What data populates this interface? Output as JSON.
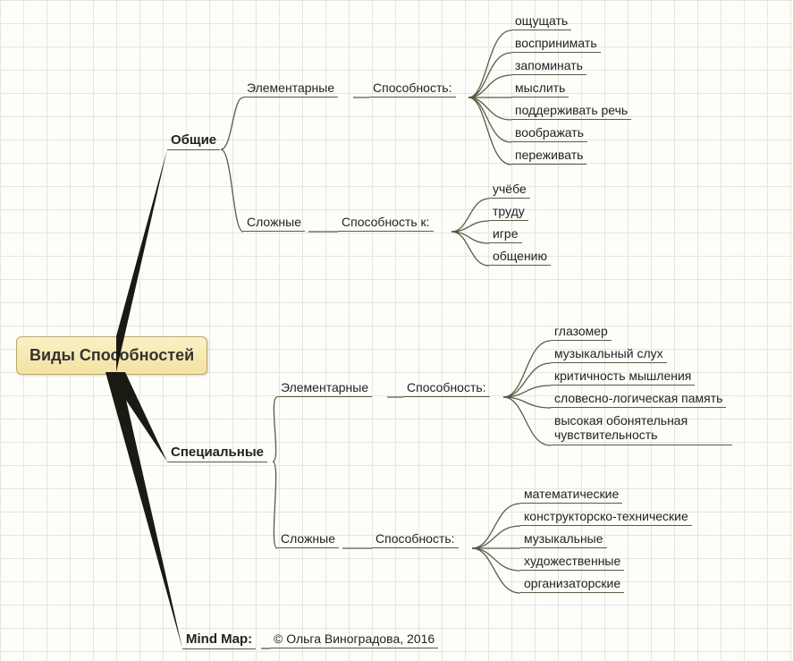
{
  "root": "Виды Способностей",
  "branches": {
    "general": {
      "label": "Общие",
      "elementary": {
        "label": "Элементарные",
        "heading": "Способность:",
        "items": [
          "ощущать",
          "воспринимать",
          "запоминать",
          "мыслить",
          "поддерживать речь",
          "воображать",
          "переживать"
        ]
      },
      "complex": {
        "label": "Сложные",
        "heading": "Способность к:",
        "items": [
          "учёбе",
          "труду",
          "игре",
          "общению"
        ]
      }
    },
    "special": {
      "label": "Специальные",
      "elementary": {
        "label": "Элементарные",
        "heading": "Способность:",
        "items": [
          "глазомер",
          "музыкальный слух",
          "критичность мышления",
          "словесно-логическая память",
          "высокая обонятельная чувствительность"
        ]
      },
      "complex": {
        "label": "Сложные",
        "heading": "Способность:",
        "items": [
          "математические",
          "конструкторско-технические",
          "музыкальные",
          "художественные",
          "организаторские"
        ]
      }
    },
    "credit": {
      "label": "Mind Map:",
      "text": "© Ольга Виноградова, 2016"
    }
  }
}
